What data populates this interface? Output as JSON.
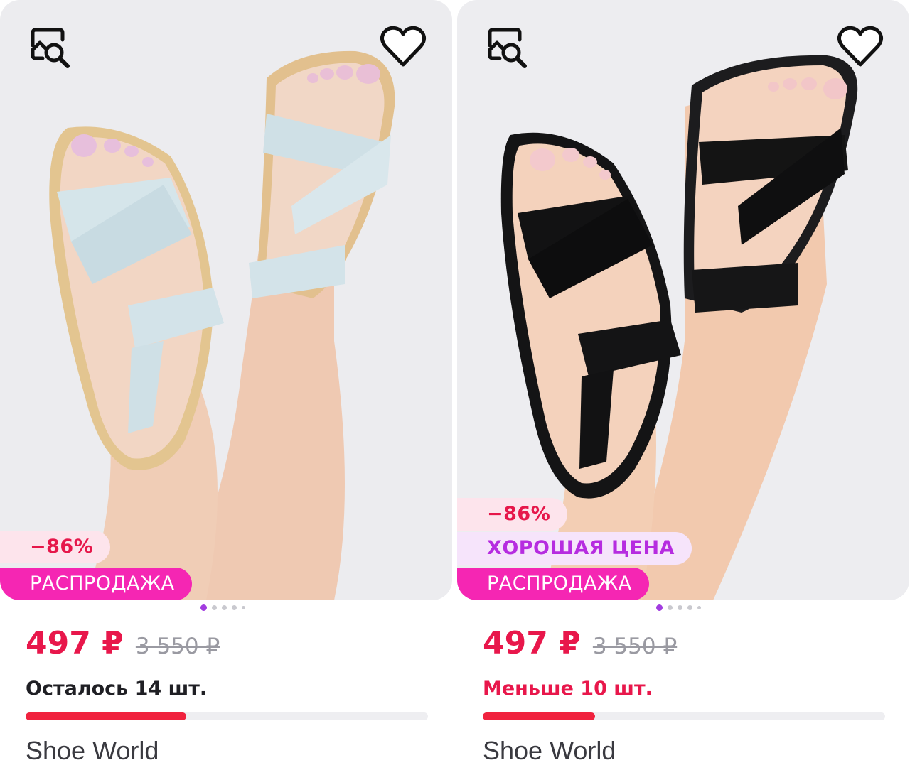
{
  "colors": {
    "accent": "#e8174b",
    "sale_pink": "#f526b3",
    "good_price_purple": "#b62ce0",
    "dot_active": "#a23ce0"
  },
  "products": [
    {
      "discount": "−86%",
      "sale_label": "РАСПРОДАЖА",
      "price": "497 ₽",
      "old_price": "3 550 ₽",
      "stock": "Осталось 14 шт.",
      "stock_fraction": 0.4,
      "brand": "Shoe World",
      "sandal_color": "light-blue",
      "icons": {
        "search": "image-search-icon",
        "favorite": "heart-icon"
      },
      "gallery_dots": 5,
      "gallery_active": 0
    },
    {
      "discount": "−86%",
      "good_price_label": "ХОРОШАЯ ЦЕНА",
      "sale_label": "РАСПРОДАЖА",
      "price": "497 ₽",
      "old_price": "3 550 ₽",
      "stock": "Меньше 10 шт.",
      "stock_fraction": 0.28,
      "brand": "Shoe World",
      "sandal_color": "black",
      "icons": {
        "search": "image-search-icon",
        "favorite": "heart-icon"
      },
      "gallery_dots": 5,
      "gallery_active": 0
    }
  ]
}
